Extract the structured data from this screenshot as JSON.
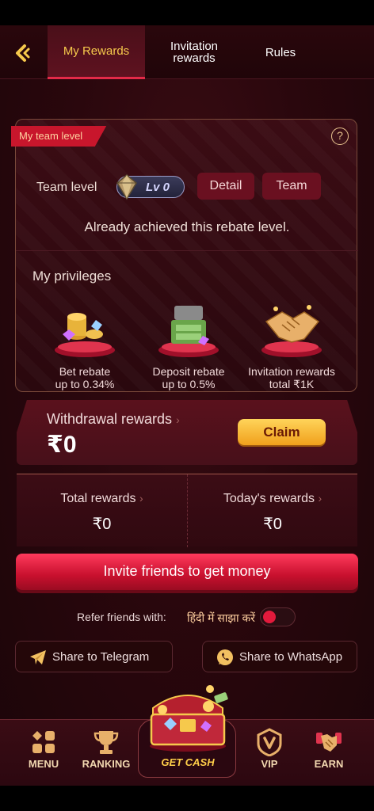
{
  "tabs": [
    {
      "label": "My Rewards",
      "active": true
    },
    {
      "label": "Invitation\nrewards",
      "active": false
    },
    {
      "label": "Rules",
      "active": false
    }
  ],
  "team": {
    "ribbon": "My team level",
    "level_label": "Team level",
    "level_value": "Lv 0",
    "detail_button": "Detail",
    "team_button": "Team",
    "status_text": "Already achieved this rebate level."
  },
  "privileges": {
    "title": "My privileges",
    "items": [
      {
        "name": "Bet rebate",
        "value": "up to 0.34%",
        "icon": "coins-icon"
      },
      {
        "name": "Deposit rebate",
        "value": "up to 0.5%",
        "icon": "cash-chest-icon"
      },
      {
        "name": "Invitation rewards",
        "value": "total ₹1K",
        "icon": "handshake-icon"
      }
    ],
    "carousel": {
      "active_index": 0,
      "count": 4
    }
  },
  "withdrawal": {
    "label": "Withdrawal rewards",
    "amount": "₹0",
    "claim_button": "Claim"
  },
  "rewards": {
    "total_label": "Total rewards",
    "total_value": "₹0",
    "today_label": "Today's rewards",
    "today_value": "₹0"
  },
  "invite_button": "Invite friends to get money",
  "refer": {
    "label": "Refer friends with:",
    "language": "हिंदी में साझा करें",
    "toggle_on": false
  },
  "share": {
    "telegram": "Share to Telegram",
    "whatsapp": "Share to WhatsApp"
  },
  "nav": {
    "menu": "MENU",
    "ranking": "RANKING",
    "get_cash": "GET CASH",
    "vip": "VIP",
    "earn": "EARN"
  },
  "colors": {
    "accent_red": "#e32a48",
    "gold": "#f6c94c",
    "background": "#2a070d"
  }
}
